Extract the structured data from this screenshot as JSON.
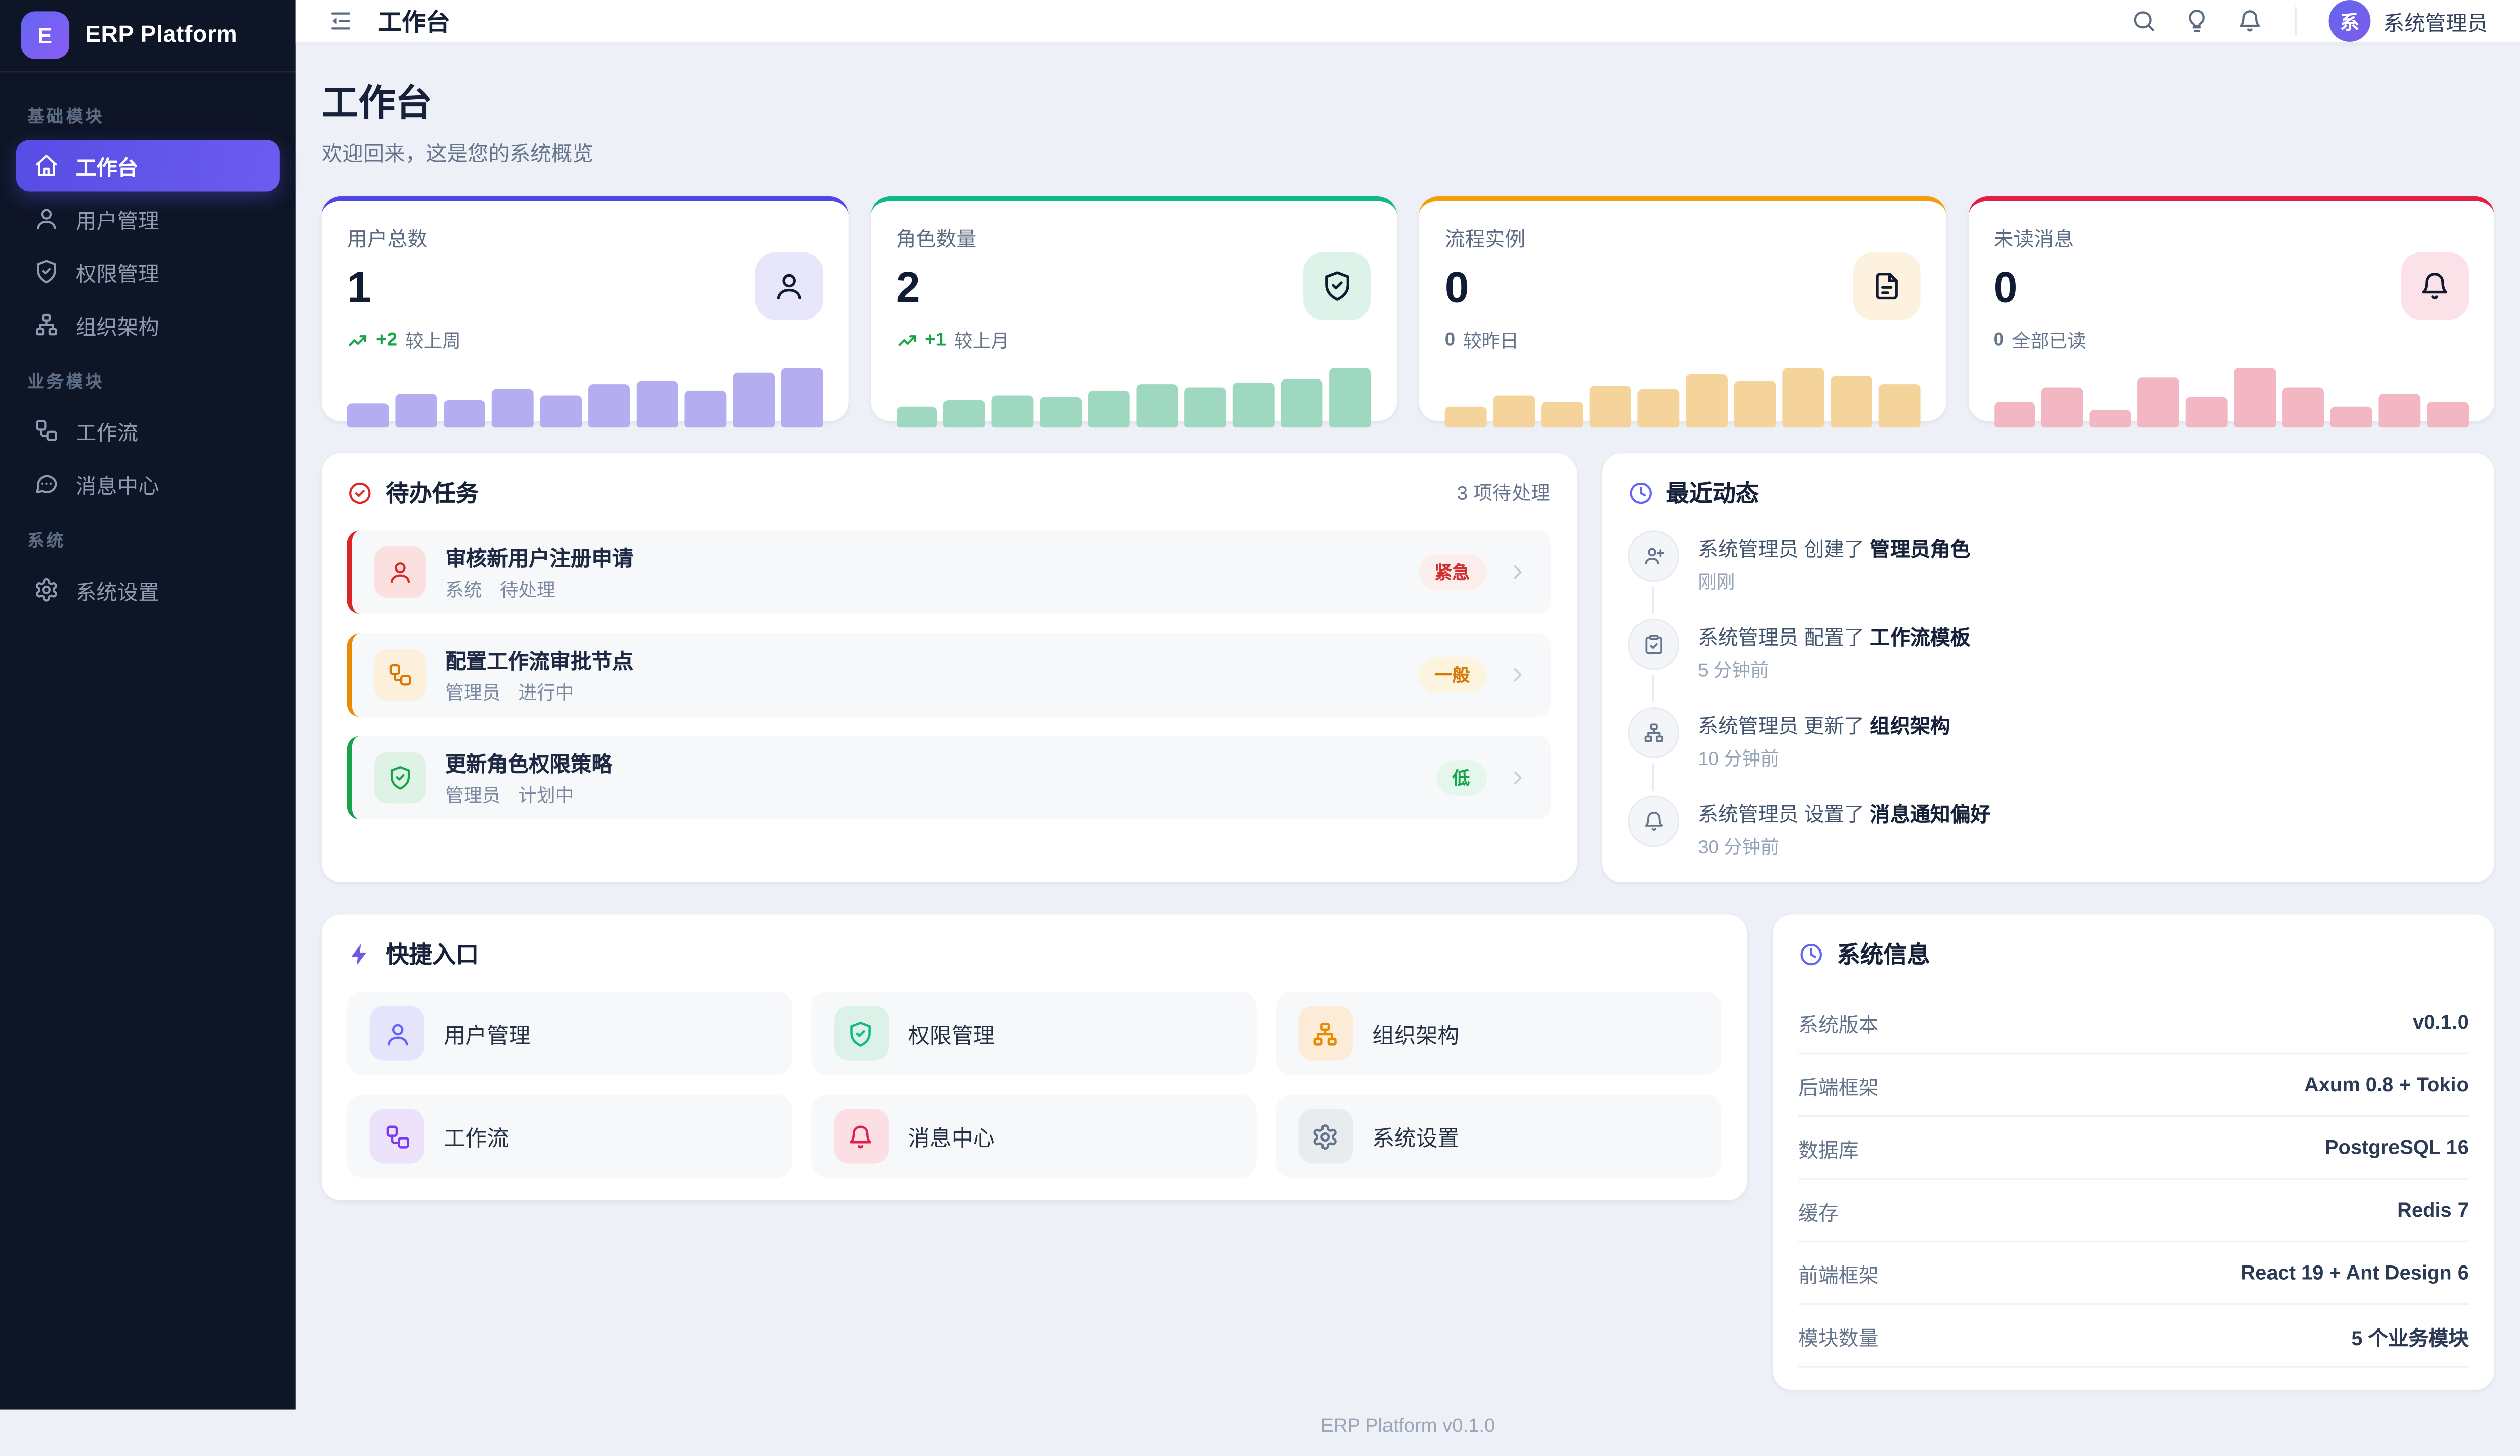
{
  "sidebar": {
    "logo_letter": "E",
    "title": "ERP Platform",
    "groups": [
      {
        "label": "基础模块",
        "items": [
          {
            "key": "workbench",
            "icon": "home",
            "label": "工作台",
            "active": true
          },
          {
            "key": "users",
            "icon": "user",
            "label": "用户管理"
          },
          {
            "key": "permissions",
            "icon": "shield-check",
            "label": "权限管理"
          },
          {
            "key": "org",
            "icon": "sitemap",
            "label": "组织架构"
          }
        ]
      },
      {
        "label": "业务模块",
        "items": [
          {
            "key": "workflow",
            "icon": "workflow",
            "label": "工作流"
          },
          {
            "key": "messages",
            "icon": "message",
            "label": "消息中心"
          }
        ]
      },
      {
        "label": "系统",
        "items": [
          {
            "key": "settings",
            "icon": "gear",
            "label": "系统设置"
          }
        ]
      }
    ]
  },
  "header": {
    "title": "工作台",
    "actions": [
      {
        "key": "search",
        "icon": "search"
      },
      {
        "key": "theme",
        "icon": "bulb"
      },
      {
        "key": "notifications",
        "icon": "bell"
      }
    ],
    "user": {
      "avatar_letter": "系",
      "name": "系统管理员"
    }
  },
  "page": {
    "title": "工作台",
    "subtitle": "欢迎回来，这是您的系统概览"
  },
  "stat_cards": [
    {
      "key": "total-users",
      "label": "用户总数",
      "value": "1",
      "icon": "user",
      "accent": "#4f46e5",
      "icon_bg": "#e7e6fb",
      "trend": {
        "arrow": true,
        "delta": "+2",
        "suffix": "较上周",
        "delta_color": "#16a34a"
      },
      "bar_color": "#b4aef1",
      "bars": [
        40,
        57,
        47,
        64,
        53,
        72,
        79,
        62,
        91,
        100
      ]
    },
    {
      "key": "role-count",
      "label": "角色数量",
      "value": "2",
      "icon": "shield-check",
      "accent": "#10b981",
      "icon_bg": "#ddf2e9",
      "trend": {
        "arrow": true,
        "delta": "+1",
        "suffix": "较上月",
        "delta_color": "#16a34a"
      },
      "bar_color": "#9ed8c0",
      "bars": [
        36,
        45,
        55,
        51,
        62,
        72,
        68,
        75,
        81,
        100
      ]
    },
    {
      "key": "process-instances",
      "label": "流程实例",
      "value": "0",
      "icon": "file-text",
      "accent": "#f59e0b",
      "icon_bg": "#fdf1df",
      "trend": {
        "arrow": false,
        "delta": "0",
        "suffix": "较昨日",
        "delta_color": "#64748b"
      },
      "bar_color": "#f5d49c",
      "bars": [
        36,
        54,
        44,
        70,
        64,
        90,
        78,
        100,
        86,
        72
      ]
    },
    {
      "key": "unread-messages",
      "label": "未读消息",
      "value": "0",
      "icon": "bell",
      "accent": "#e11d48",
      "icon_bg": "#fbe2e9",
      "trend": {
        "arrow": false,
        "delta": "0",
        "suffix": "全部已读",
        "delta_color": "#64748b"
      },
      "bar_color": "#f3b7c3",
      "bars": [
        43,
        67,
        29,
        84,
        51,
        100,
        67,
        35,
        57,
        43
      ]
    }
  ],
  "todo": {
    "icon_color": "#dc2626",
    "title": "待办任务",
    "count_text": "3 项待处理",
    "tasks": [
      {
        "title": "审核新用户注册申请",
        "source": "系统",
        "status": "待处理",
        "icon": "user",
        "accent": "#dc2626",
        "icon_bg": "#fbe0e0",
        "icon_color": "#dc2626",
        "badge": {
          "text": "紧急",
          "color": "#d23030",
          "bg": "#fdeeee"
        }
      },
      {
        "title": "配置工作流审批节点",
        "source": "管理员",
        "status": "进行中",
        "icon": "workflow",
        "accent": "#ea8a00",
        "icon_bg": "#fcefdc",
        "icon_color": "#d97706",
        "badge": {
          "text": "一般",
          "color": "#d97706",
          "bg": "#fdf4e0"
        }
      },
      {
        "title": "更新角色权限策略",
        "source": "管理员",
        "status": "计划中",
        "icon": "shield-check",
        "accent": "#16a34a",
        "icon_bg": "#def3e6",
        "icon_color": "#16a34a",
        "badge": {
          "text": "低",
          "color": "#16a34a",
          "bg": "#e5f6ec"
        }
      }
    ]
  },
  "activity": {
    "icon_color": "#6366f1",
    "title": "最近动态",
    "items": [
      {
        "icon": "user-plus",
        "actor": "系统管理员",
        "action": "创建了",
        "object": "管理员角色",
        "time": "刚刚"
      },
      {
        "icon": "clipboard-check",
        "actor": "系统管理员",
        "action": "配置了",
        "object": "工作流模板",
        "time": "5 分钟前"
      },
      {
        "icon": "sitemap",
        "actor": "系统管理员",
        "action": "更新了",
        "object": "组织架构",
        "time": "10 分钟前"
      },
      {
        "icon": "bell",
        "actor": "系统管理员",
        "action": "设置了",
        "object": "消息通知偏好",
        "time": "30 分钟前"
      }
    ]
  },
  "quick": {
    "icon_color": "#6d5ae8",
    "title": "快捷入口",
    "links": [
      {
        "key": "users",
        "label": "用户管理",
        "icon": "user",
        "color": "#6366f1",
        "bg": "#e5e4fb"
      },
      {
        "key": "perms",
        "label": "权限管理",
        "icon": "shield-check",
        "color": "#10b981",
        "bg": "#dcf2e9"
      },
      {
        "key": "org",
        "label": "组织架构",
        "icon": "sitemap",
        "color": "#ea8a00",
        "bg": "#fcecd7"
      },
      {
        "key": "workflow",
        "label": "工作流",
        "icon": "workflow",
        "color": "#7c3aed",
        "bg": "#ece3fb"
      },
      {
        "key": "messages",
        "label": "消息中心",
        "icon": "bell",
        "color": "#e11d48",
        "bg": "#fbdfe5"
      },
      {
        "key": "settings",
        "label": "系统设置",
        "icon": "gear",
        "color": "#64748b",
        "bg": "#e8ebf0"
      }
    ]
  },
  "sysinfo": {
    "icon_color": "#6366f1",
    "title": "系统信息",
    "rows": [
      {
        "label": "系统版本",
        "value": "v0.1.0"
      },
      {
        "label": "后端框架",
        "value": "Axum 0.8 + Tokio"
      },
      {
        "label": "数据库",
        "value": "PostgreSQL 16"
      },
      {
        "label": "缓存",
        "value": "Redis 7"
      },
      {
        "label": "前端框架",
        "value": "React 19 + Ant Design 6"
      },
      {
        "label": "模块数量",
        "value": "5 个业务模块"
      }
    ]
  },
  "footer": {
    "text": "ERP Platform v0.1.0"
  }
}
